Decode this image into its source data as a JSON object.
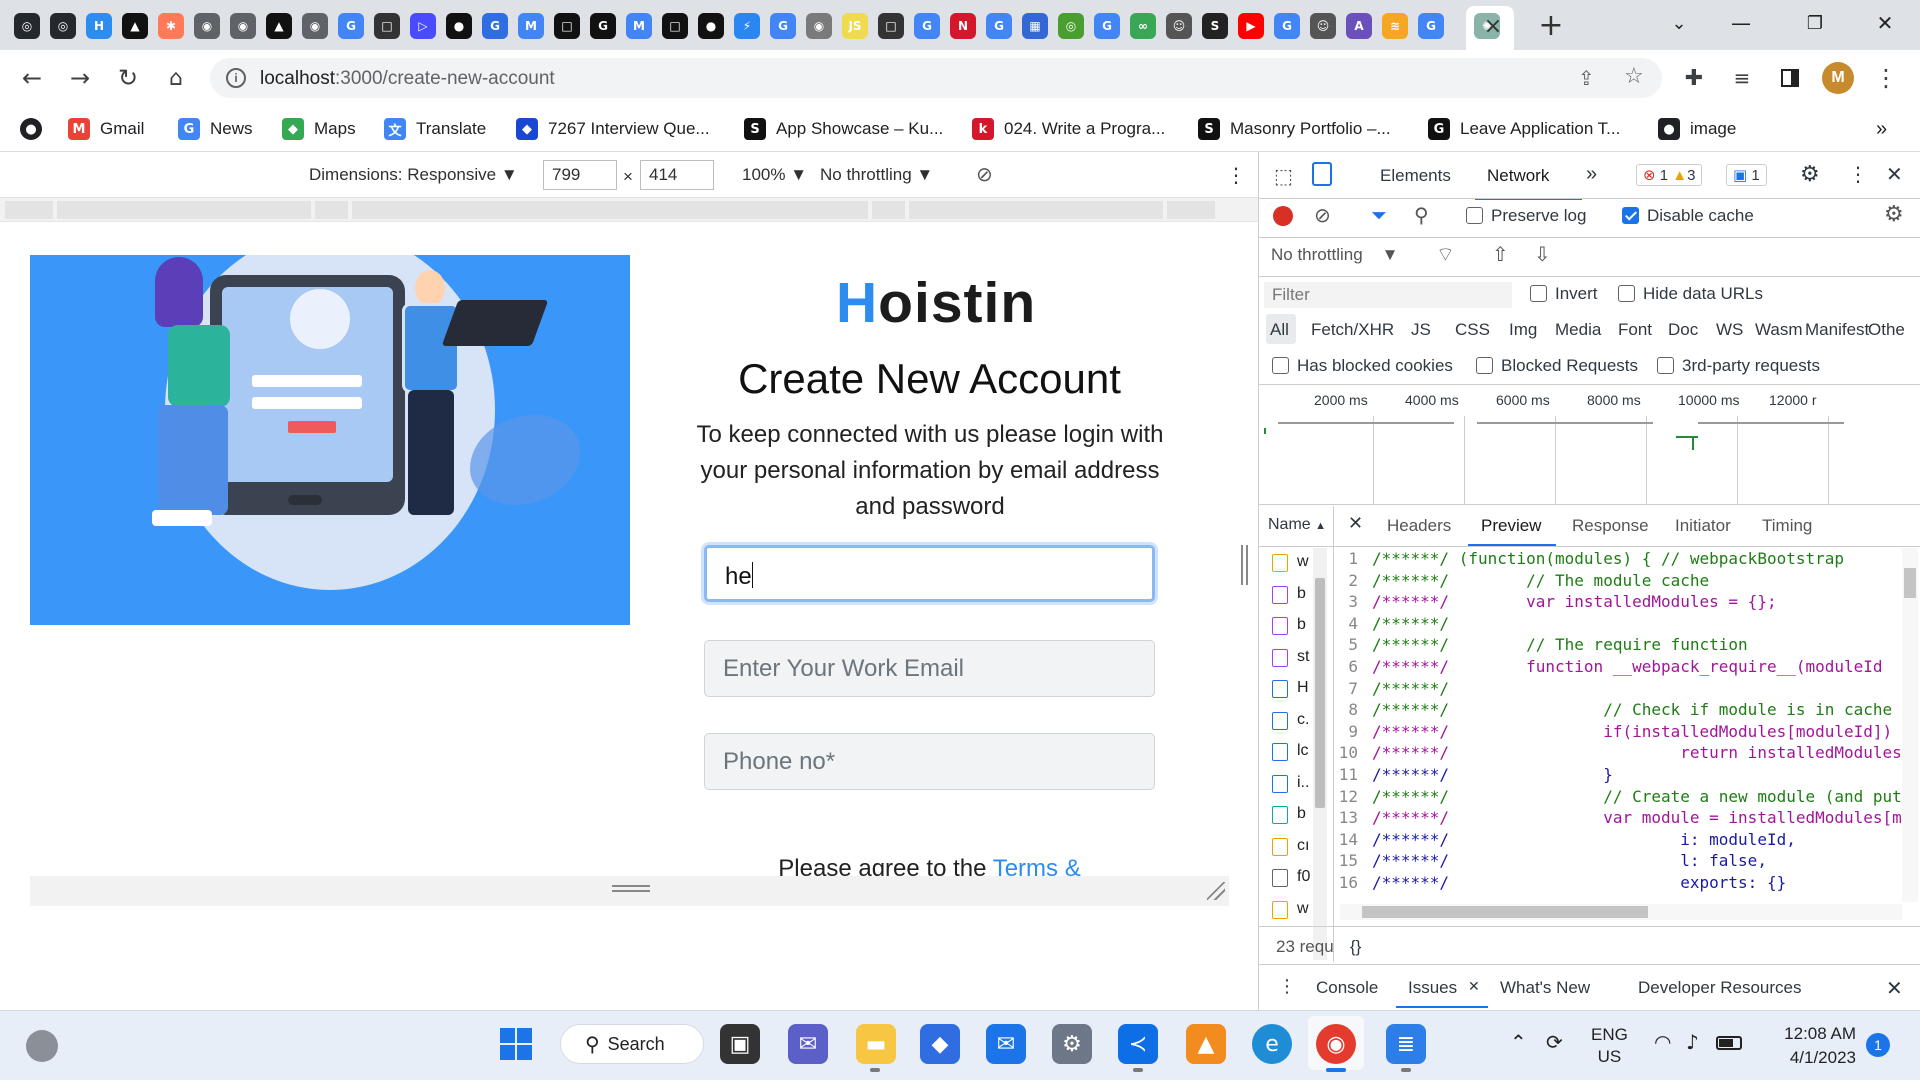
{
  "browser": {
    "tabs_count_visible": 44,
    "active_tab_close": "×",
    "new_tab": "+",
    "window_controls": {
      "minimize": "—",
      "restore": "❐",
      "close": "✕"
    },
    "url_host": "localhost",
    "url_path": ":3000/create-new-account",
    "profile_initial": "M"
  },
  "bookmarks": [
    {
      "label": "Gmail",
      "icon": "gmail-icon",
      "color": "#ea4335",
      "glyph": "M"
    },
    {
      "label": "News",
      "icon": "google-icon",
      "color": "#4285f4",
      "glyph": "G"
    },
    {
      "label": "Maps",
      "icon": "maps-pin-icon",
      "color": "#34a853",
      "glyph": "◆"
    },
    {
      "label": "Translate",
      "icon": "translate-icon",
      "color": "#4285f4",
      "glyph": "文"
    },
    {
      "label": "7267 Interview Que...",
      "icon": "interview-icon",
      "color": "#1a47d1",
      "glyph": "◆"
    },
    {
      "label": "App Showcase – Ku...",
      "icon": "s-icon",
      "color": "#111111",
      "glyph": "S"
    },
    {
      "label": "024. Write a Progra...",
      "icon": "k-icon",
      "color": "#d4172a",
      "glyph": "k"
    },
    {
      "label": "Masonry Portfolio –...",
      "icon": "s-icon",
      "color": "#111111",
      "glyph": "S"
    },
    {
      "label": "Leave Application T...",
      "icon": "google-icon",
      "color": "#111111",
      "glyph": "G"
    },
    {
      "label": "image",
      "icon": "globe-icon",
      "color": "#202124",
      "glyph": "●"
    }
  ],
  "bookmarks_more": "»",
  "device_toolbar": {
    "dimensions_label": "Dimensions: Responsive",
    "width": "799",
    "times": "×",
    "height": "414",
    "zoom": "100%",
    "throttle": "No throttling"
  },
  "page": {
    "logo_first": "H",
    "logo_rest": "oistin",
    "title": "Create New Account",
    "subtitle": "To keep connected with us please login with your personal information by email address and password",
    "name_value": "he",
    "email_placeholder": "Enter Your Work Email",
    "phone_placeholder": "Phone no*",
    "terms_text": "Please agree to the ",
    "terms_link": "Terms &"
  },
  "devtools": {
    "tabs": [
      "Elements",
      "Network"
    ],
    "active_tab": "Network",
    "more_tabs": "»",
    "errors": "1",
    "warnings": "3",
    "messages": "1",
    "preserve_log": "Preserve log",
    "disable_cache": "Disable cache",
    "throttle": "No throttling",
    "filter_placeholder": "Filter",
    "invert": "Invert",
    "hide_data_urls": "Hide data URLs",
    "types": [
      "All",
      "Fetch/XHR",
      "JS",
      "CSS",
      "Img",
      "Media",
      "Font",
      "Doc",
      "WS",
      "Wasm",
      "Manifest",
      "Othe"
    ],
    "has_blocked_cookies": "Has blocked cookies",
    "blocked_requests": "Blocked Requests",
    "third_party": "3rd-party requests",
    "timeline_ticks": [
      "2000 ms",
      "4000 ms",
      "6000 ms",
      "8000 ms",
      "10000 ms",
      "12000 r"
    ],
    "name_col": "Name",
    "detail_tabs": [
      "Headers",
      "Preview",
      "Response",
      "Initiator",
      "Timing"
    ],
    "active_detail_tab": "Preview",
    "requests": [
      "w",
      "b",
      "b",
      "st",
      "H",
      "c.",
      "lc",
      "i..",
      "b",
      "cı",
      "f0",
      "w"
    ],
    "request_icons": [
      "js",
      "css",
      "css",
      "css",
      "doc",
      "img",
      "doc",
      "doc",
      "font",
      "js",
      "other",
      "js"
    ],
    "request_count": "23 requ",
    "format_button": "{}",
    "code_lines": [
      {
        "n": "1",
        "t": "/******/ (function(modules) { // webpackBootstrap"
      },
      {
        "n": "2",
        "t": "/******/ \t// The module cache"
      },
      {
        "n": "3",
        "t": "/******/ \tvar installedModules = {};"
      },
      {
        "n": "4",
        "t": "/******/"
      },
      {
        "n": "5",
        "t": "/******/ \t// The require function"
      },
      {
        "n": "6",
        "t": "/******/ \tfunction __webpack_require__(moduleId"
      },
      {
        "n": "7",
        "t": "/******/"
      },
      {
        "n": "8",
        "t": "/******/ \t\t// Check if module is in cache"
      },
      {
        "n": "9",
        "t": "/******/ \t\tif(installedModules[moduleId]) {"
      },
      {
        "n": "10",
        "t": "/******/ \t\t\treturn installedModules[modul"
      },
      {
        "n": "11",
        "t": "/******/ \t\t}"
      },
      {
        "n": "12",
        "t": "/******/ \t\t// Create a new module (and put i"
      },
      {
        "n": "13",
        "t": "/******/ \t\tvar module = installedModules[moc"
      },
      {
        "n": "14",
        "t": "/******/ \t\t\ti: moduleId,"
      },
      {
        "n": "15",
        "t": "/******/ \t\t\tl: false,"
      },
      {
        "n": "16",
        "t": "/******/ \t\t\texports: {}"
      }
    ],
    "drawer_tabs": [
      "Console",
      "Issues",
      "What's New",
      "Developer Resources"
    ],
    "active_drawer_tab": "Issues"
  },
  "taskbar": {
    "search_label": "Search",
    "lang_top": "ENG",
    "lang_bottom": "US",
    "time": "12:08 AM",
    "date": "4/1/2023",
    "notification_count": "1"
  }
}
